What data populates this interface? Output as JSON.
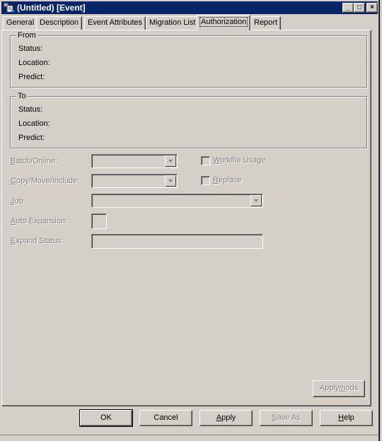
{
  "window": {
    "title": "(Untitled) [Event]",
    "app_icon": "event-document-icon",
    "controls": {
      "minimize": "_",
      "maximize": "□",
      "close": "×"
    }
  },
  "tabs": [
    {
      "label": "General",
      "active": false
    },
    {
      "label": "Description",
      "active": false
    },
    {
      "label": "Event Attributes",
      "active": false
    },
    {
      "label": "Migration List",
      "active": false
    },
    {
      "label": "Authorization",
      "active": true
    },
    {
      "label": "Report",
      "active": false
    }
  ],
  "from_group": {
    "title": "From",
    "fields": [
      "Status:",
      "Location:",
      "Predict:"
    ]
  },
  "to_group": {
    "title": "To",
    "fields": [
      "Status:",
      "Location:",
      "Predict:"
    ]
  },
  "form": {
    "batch_online": {
      "label_first": "B",
      "label_rest": "atch/Online:",
      "value": ""
    },
    "copy_move_include": {
      "label_first": "C",
      "label_rest": "opy/Move/Include:",
      "value": ""
    },
    "job": {
      "label_first": "J",
      "label_rest": "ob:",
      "value": ""
    },
    "auto_expansion": {
      "label_first": "A",
      "label_rest": "uto Expansion:",
      "value": ""
    },
    "expand_status": {
      "label_first": "E",
      "label_rest": "xpand Status:",
      "value": ""
    },
    "workfile_usage": {
      "label_first": "W",
      "label_rest": "orkfile Usage",
      "checked": false
    },
    "replace": {
      "label_first": "R",
      "label_rest": "eplace",
      "checked": false
    }
  },
  "applymods_button": {
    "pre": "Apply",
    "accel": "m",
    "post": "ods"
  },
  "buttons": {
    "ok": {
      "label": "OK"
    },
    "cancel": {
      "label": "Cancel"
    },
    "apply": {
      "accel": "A",
      "rest": "pply"
    },
    "save_as": {
      "accel": "S",
      "rest": "ave As"
    },
    "help": {
      "accel": "H",
      "rest": "elp"
    }
  }
}
